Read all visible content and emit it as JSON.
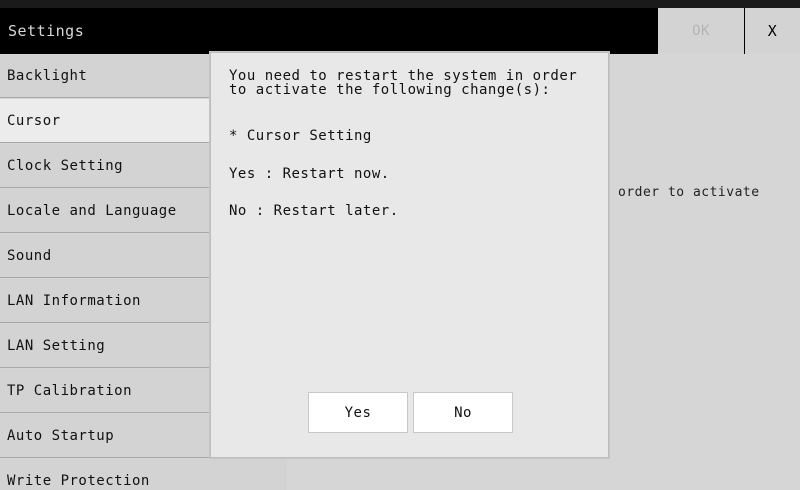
{
  "titlebar": {
    "title": "Settings",
    "ok_label": "OK",
    "close_label": "X"
  },
  "sidebar": {
    "items": [
      {
        "label": "Backlight"
      },
      {
        "label": "Cursor"
      },
      {
        "label": "Clock Setting"
      },
      {
        "label": "Locale and Language"
      },
      {
        "label": "Sound"
      },
      {
        "label": "LAN Information"
      },
      {
        "label": "LAN Setting"
      },
      {
        "label": "TP Calibration"
      },
      {
        "label": "Auto Startup"
      },
      {
        "label": "Write Protection"
      }
    ],
    "selected": "Cursor"
  },
  "content": {
    "partial_text": "order to activate"
  },
  "dialog": {
    "message": "You need to restart the system in order to activate the following change(s):",
    "change_item": "* Cursor Setting",
    "yes_info": "Yes : Restart now.",
    "no_info": "No : Restart later.",
    "yes_label": "Yes",
    "no_label": "No"
  }
}
